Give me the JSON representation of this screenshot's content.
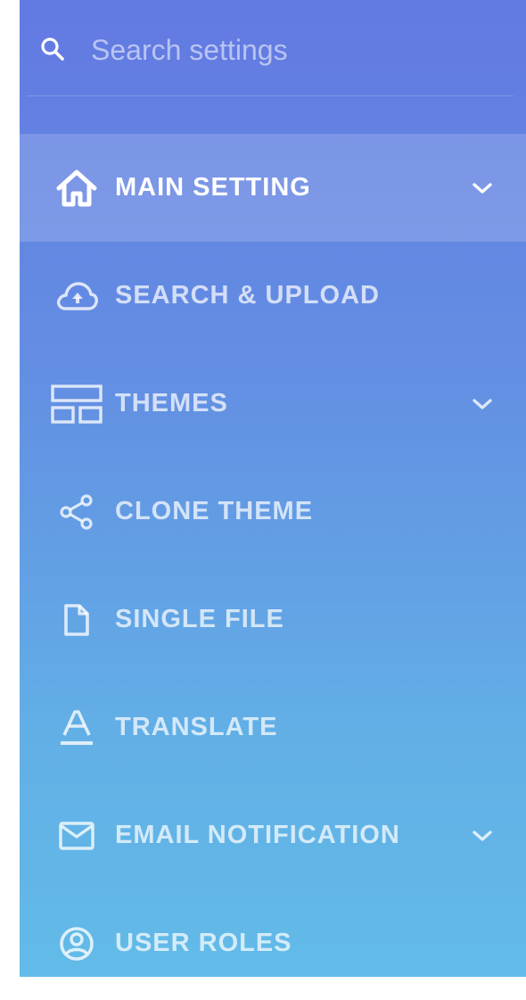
{
  "search": {
    "placeholder": "Search settings",
    "icon": "search-icon"
  },
  "colors": {
    "gradient_top": "#6379e2",
    "gradient_bottom": "#62bbe8",
    "active_item_bg": "rgba(255,255,255,0.16)",
    "text": "#ffffff"
  },
  "menu": {
    "items": [
      {
        "label": "MAIN SETTING",
        "icon": "home-icon",
        "active": true,
        "expandable": true
      },
      {
        "label": "SEARCH & UPLOAD",
        "icon": "cloud-upload-icon",
        "active": false,
        "expandable": false
      },
      {
        "label": "THEMES",
        "icon": "layout-icon",
        "active": false,
        "expandable": true
      },
      {
        "label": "CLONE THEME",
        "icon": "share-icon",
        "active": false,
        "expandable": false
      },
      {
        "label": "SINGLE FILE",
        "icon": "file-icon",
        "active": false,
        "expandable": false
      },
      {
        "label": "TRANSLATE",
        "icon": "text-format-icon",
        "active": false,
        "expandable": false
      },
      {
        "label": "EMAIL NOTIFICATION",
        "icon": "mail-icon",
        "active": false,
        "expandable": true
      },
      {
        "label": "USER ROLES",
        "icon": "user-circle-icon",
        "active": false,
        "expandable": false
      }
    ]
  }
}
